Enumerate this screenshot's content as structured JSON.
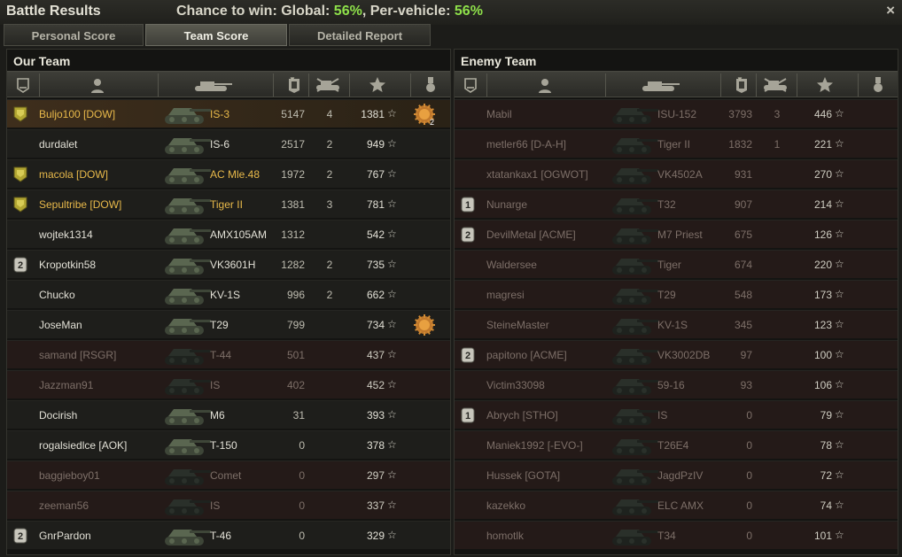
{
  "window": {
    "title": "Battle Results",
    "chance_label": "Chance to win: Global:",
    "global_pct": "56%",
    "per_vehicle_label": ", Per-vehicle:",
    "per_vehicle_pct": "56%",
    "close_icon": "×"
  },
  "tabs": [
    {
      "label": "Personal Score",
      "active": false
    },
    {
      "label": "Team Score",
      "active": true
    },
    {
      "label": "Detailed Report",
      "active": false
    }
  ],
  "colors": {
    "squad": "#e8b94a",
    "accent_green": "#8ee04a",
    "dead_text": "#7d6f68"
  },
  "columns": [
    "squad-badge-icon",
    "player-icon",
    "vehicle-icon",
    "damage-icon",
    "kills-icon",
    "xp-star-icon",
    "medal-icon"
  ],
  "our_team": {
    "title": "Our Team",
    "rows": [
      {
        "badge": "squad",
        "player": "Buljo100 [DOW]",
        "tank": "IS-3",
        "damage": "5147",
        "kills": "4",
        "xp": "1381",
        "medal": "2",
        "status": "hl"
      },
      {
        "badge": "",
        "player": "durdalet",
        "tank": "IS-6",
        "damage": "2517",
        "kills": "2",
        "xp": "949",
        "medal": "",
        "status": "alive"
      },
      {
        "badge": "squad",
        "player": "macola [DOW]",
        "tank": "AC Mle.48",
        "damage": "1972",
        "kills": "2",
        "xp": "767",
        "medal": "",
        "status": "alive"
      },
      {
        "badge": "squad",
        "player": "Sepultribe [DOW]",
        "tank": "Tiger II",
        "damage": "1381",
        "kills": "3",
        "xp": "781",
        "medal": "",
        "status": "alive"
      },
      {
        "badge": "",
        "player": "wojtek1314",
        "tank": "AMX105AM",
        "damage": "1312",
        "kills": "",
        "xp": "542",
        "medal": "",
        "status": "alive"
      },
      {
        "badge": "2",
        "player": "Kropotkin58",
        "tank": "VK3601H",
        "damage": "1282",
        "kills": "2",
        "xp": "735",
        "medal": "",
        "status": "alive"
      },
      {
        "badge": "",
        "player": "Chucko",
        "tank": "KV-1S",
        "damage": "996",
        "kills": "2",
        "xp": "662",
        "medal": "",
        "status": "alive"
      },
      {
        "badge": "",
        "player": "JoseMan",
        "tank": "T29",
        "damage": "799",
        "kills": "",
        "xp": "734",
        "medal": "1",
        "status": "alive"
      },
      {
        "badge": "",
        "player": "samand [RSGR]",
        "tank": "T-44",
        "damage": "501",
        "kills": "",
        "xp": "437",
        "medal": "",
        "status": "dead"
      },
      {
        "badge": "",
        "player": "Jazzman91",
        "tank": "IS",
        "damage": "402",
        "kills": "",
        "xp": "452",
        "medal": "",
        "status": "dead"
      },
      {
        "badge": "",
        "player": "Docirish",
        "tank": "M6",
        "damage": "31",
        "kills": "",
        "xp": "393",
        "medal": "",
        "status": "alive"
      },
      {
        "badge": "",
        "player": "rogalsiedlce [AOK]",
        "tank": "T-150",
        "damage": "0",
        "kills": "",
        "xp": "378",
        "medal": "",
        "status": "alive"
      },
      {
        "badge": "",
        "player": "baggieboy01",
        "tank": "Comet",
        "damage": "0",
        "kills": "",
        "xp": "297",
        "medal": "",
        "status": "dead"
      },
      {
        "badge": "",
        "player": "zeeman56",
        "tank": "IS",
        "damage": "0",
        "kills": "",
        "xp": "337",
        "medal": "",
        "status": "dead"
      },
      {
        "badge": "2",
        "player": "GnrPardon",
        "tank": "T-46",
        "damage": "0",
        "kills": "",
        "xp": "329",
        "medal": "",
        "status": "alive"
      }
    ]
  },
  "enemy_team": {
    "title": "Enemy Team",
    "rows": [
      {
        "badge": "",
        "player": "Mabil",
        "tank": "ISU-152",
        "damage": "3793",
        "kills": "3",
        "xp": "446",
        "medal": "",
        "status": "dead"
      },
      {
        "badge": "",
        "player": "metler66 [D-A-H]",
        "tank": "Tiger II",
        "damage": "1832",
        "kills": "1",
        "xp": "221",
        "medal": "",
        "status": "dead"
      },
      {
        "badge": "",
        "player": "xtatankax1 [OGWOT]",
        "tank": "VK4502A",
        "damage": "931",
        "kills": "",
        "xp": "270",
        "medal": "",
        "status": "dead"
      },
      {
        "badge": "1",
        "player": "Nunarge",
        "tank": "T32",
        "damage": "907",
        "kills": "",
        "xp": "214",
        "medal": "",
        "status": "dead"
      },
      {
        "badge": "2",
        "player": "DevilMetal [ACME]",
        "tank": "M7 Priest",
        "damage": "675",
        "kills": "",
        "xp": "126",
        "medal": "",
        "status": "dead"
      },
      {
        "badge": "",
        "player": "Waldersee",
        "tank": "Tiger",
        "damage": "674",
        "kills": "",
        "xp": "220",
        "medal": "",
        "status": "dead"
      },
      {
        "badge": "",
        "player": "magresi",
        "tank": "T29",
        "damage": "548",
        "kills": "",
        "xp": "173",
        "medal": "",
        "status": "dead"
      },
      {
        "badge": "",
        "player": "SteineMaster",
        "tank": "KV-1S",
        "damage": "345",
        "kills": "",
        "xp": "123",
        "medal": "",
        "status": "dead"
      },
      {
        "badge": "2",
        "player": "papitono [ACME]",
        "tank": "VK3002DB",
        "damage": "97",
        "kills": "",
        "xp": "100",
        "medal": "",
        "status": "dead"
      },
      {
        "badge": "",
        "player": "Victim33098",
        "tank": "59-16",
        "damage": "93",
        "kills": "",
        "xp": "106",
        "medal": "",
        "status": "dead"
      },
      {
        "badge": "1",
        "player": "Abrych [STHO]",
        "tank": "IS",
        "damage": "0",
        "kills": "",
        "xp": "79",
        "medal": "",
        "status": "dead"
      },
      {
        "badge": "",
        "player": "Maniek1992 [-EVO-]",
        "tank": "T26E4",
        "damage": "0",
        "kills": "",
        "xp": "78",
        "medal": "",
        "status": "dead"
      },
      {
        "badge": "",
        "player": "Hussek [GOTA]",
        "tank": "JagdPzIV",
        "damage": "0",
        "kills": "",
        "xp": "72",
        "medal": "",
        "status": "dead"
      },
      {
        "badge": "",
        "player": "kazekko",
        "tank": "ELC AMX",
        "damage": "0",
        "kills": "",
        "xp": "74",
        "medal": "",
        "status": "dead"
      },
      {
        "badge": "",
        "player": "homotlk",
        "tank": "T34",
        "damage": "0",
        "kills": "",
        "xp": "101",
        "medal": "",
        "status": "dead"
      }
    ]
  }
}
